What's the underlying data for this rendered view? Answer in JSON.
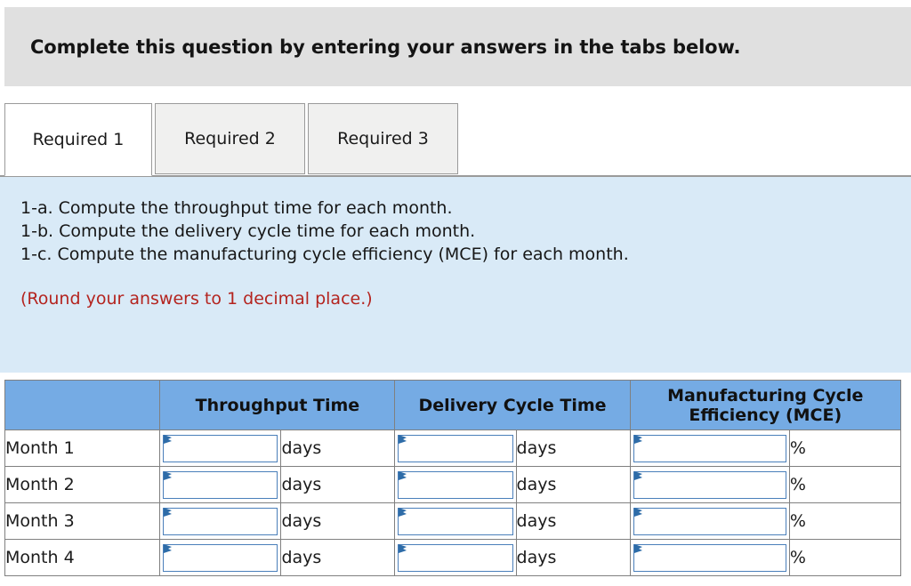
{
  "banner": {
    "text": "Complete this question by entering your answers in the tabs below."
  },
  "tabs": [
    {
      "label": "Required 1",
      "active": true
    },
    {
      "label": "Required 2",
      "active": false
    },
    {
      "label": "Required 3",
      "active": false
    }
  ],
  "instructions": {
    "lines": [
      "1-a. Compute the throughput time for each month.",
      "1-b. Compute the delivery cycle time for each month.",
      "1-c. Compute the manufacturing cycle efficiency (MCE) for each month."
    ],
    "note": "(Round your answers to 1 decimal place.)",
    "note_color": "#b4241f"
  },
  "table": {
    "header_bg": "#75abe4",
    "columns": [
      "",
      "Throughput Time",
      "Delivery Cycle Time",
      "Manufacturing Cycle Efficiency (MCE)"
    ],
    "rows": [
      {
        "label": "Month 1",
        "throughput_value": "",
        "throughput_unit": "days",
        "delivery_value": "",
        "delivery_unit": "days",
        "mce_value": "",
        "mce_unit": "%"
      },
      {
        "label": "Month 2",
        "throughput_value": "",
        "throughput_unit": "days",
        "delivery_value": "",
        "delivery_unit": "days",
        "mce_value": "",
        "mce_unit": "%"
      },
      {
        "label": "Month 3",
        "throughput_value": "",
        "throughput_unit": "days",
        "delivery_value": "",
        "delivery_unit": "days",
        "mce_value": "",
        "mce_unit": "%"
      },
      {
        "label": "Month 4",
        "throughput_value": "",
        "throughput_unit": "days",
        "delivery_value": "",
        "delivery_unit": "days",
        "mce_value": "",
        "mce_unit": "%"
      }
    ]
  }
}
